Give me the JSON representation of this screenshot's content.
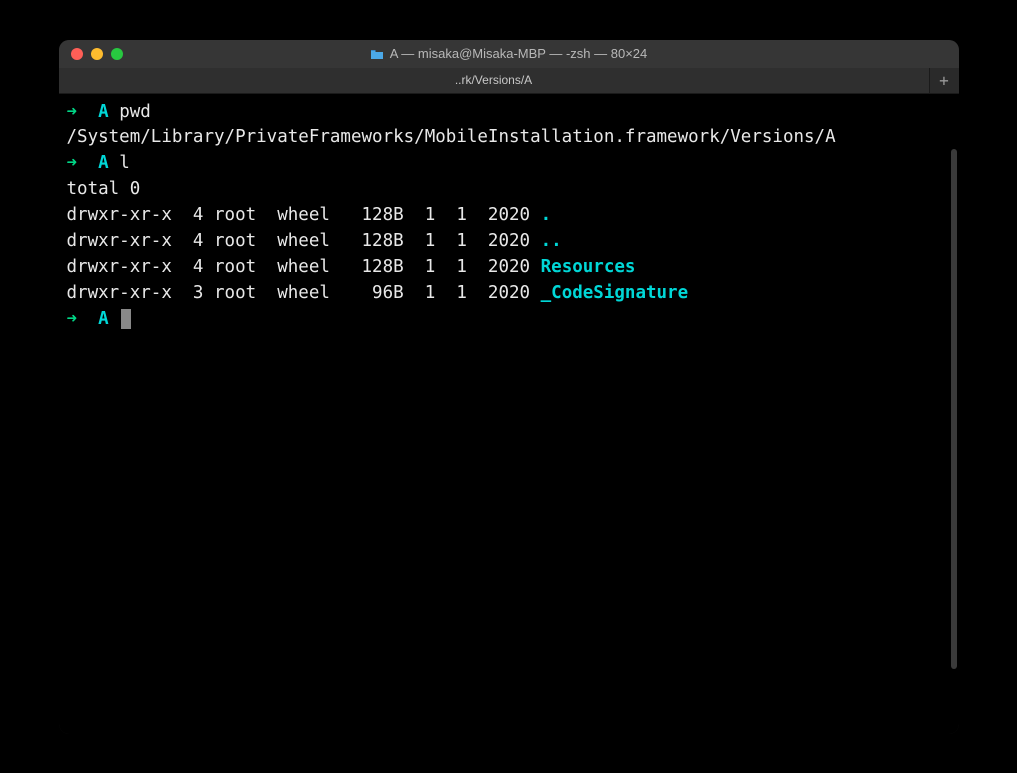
{
  "window": {
    "title": "A — misaka@Misaka-MBP — -zsh — 80×24"
  },
  "tabs": {
    "active_label": "..rk/Versions/A",
    "add_label": "+"
  },
  "prompt": {
    "arrow": "➜",
    "dir": "A"
  },
  "lines": [
    {
      "type": "prompt",
      "cmd": "pwd"
    },
    {
      "type": "output",
      "text": "/System/Library/PrivateFrameworks/MobileInstallation.framework/Versions/A"
    },
    {
      "type": "prompt",
      "cmd": "l"
    },
    {
      "type": "output",
      "text": "total 0"
    },
    {
      "type": "ls",
      "perms": "drwxr-xr-x",
      "links": "4",
      "owner": "root",
      "group": "wheel",
      "size": "128B",
      "month": "1",
      "day": "1",
      "year": "2020",
      "name": ".",
      "dir": true
    },
    {
      "type": "ls",
      "perms": "drwxr-xr-x",
      "links": "4",
      "owner": "root",
      "group": "wheel",
      "size": "128B",
      "month": "1",
      "day": "1",
      "year": "2020",
      "name": "..",
      "dir": true
    },
    {
      "type": "ls",
      "perms": "drwxr-xr-x",
      "links": "4",
      "owner": "root",
      "group": "wheel",
      "size": "128B",
      "month": "1",
      "day": "1",
      "year": "2020",
      "name": "Resources",
      "dir": true
    },
    {
      "type": "ls",
      "perms": "drwxr-xr-x",
      "links": "3",
      "owner": "root",
      "group": "wheel",
      "size": "96B",
      "month": "1",
      "day": "1",
      "year": "2020",
      "name": "_CodeSignature",
      "dir": true
    },
    {
      "type": "prompt",
      "cmd": "",
      "cursor": true
    }
  ]
}
